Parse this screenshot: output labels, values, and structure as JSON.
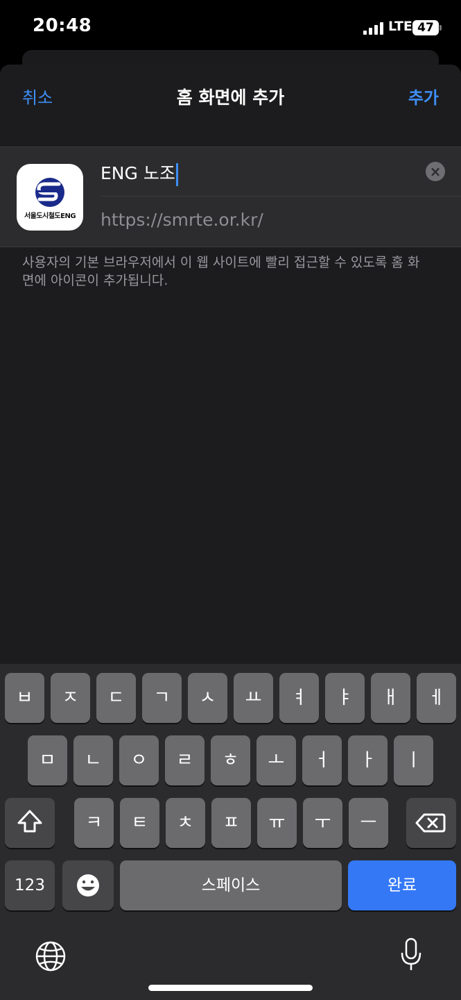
{
  "status_bar": {
    "time": "20:48",
    "network": "LTE",
    "battery": "47"
  },
  "nav": {
    "cancel": "취소",
    "title": "홈 화면에 추가",
    "add": "추가"
  },
  "app_icon": {
    "label": "서울도시철도ENG",
    "icon": "seoul-metro-eng-logo-icon"
  },
  "form": {
    "name_value": "ENG 노조",
    "url": "https://smrte.or.kr/"
  },
  "description": "사용자의 기본 브라우저에서 이 웹 사이트에 빨리 접근할 수 있도록 홈 화면에 아이콘이 추가됩니다.",
  "keyboard": {
    "row1": [
      "ㅂ",
      "ㅈ",
      "ㄷ",
      "ㄱ",
      "ㅅ",
      "ㅛ",
      "ㅕ",
      "ㅑ",
      "ㅐ",
      "ㅔ"
    ],
    "row2": [
      "ㅁ",
      "ㄴ",
      "ㅇ",
      "ㄹ",
      "ㅎ",
      "ㅗ",
      "ㅓ",
      "ㅏ",
      "ㅣ"
    ],
    "row3": [
      "ㅋ",
      "ㅌ",
      "ㅊ",
      "ㅍ",
      "ㅠ",
      "ㅜ",
      "ㅡ"
    ],
    "numbers": "123",
    "space": "스페이스",
    "done": "완료",
    "icons": [
      "shift-icon",
      "backspace-icon",
      "emoji-icon",
      "globe-icon",
      "microphone-icon"
    ]
  },
  "colors": {
    "accent": "#3e8ff7",
    "done_key": "#3478f6",
    "sheet": "#1c1c1e",
    "logo": "#1a2a8a"
  }
}
